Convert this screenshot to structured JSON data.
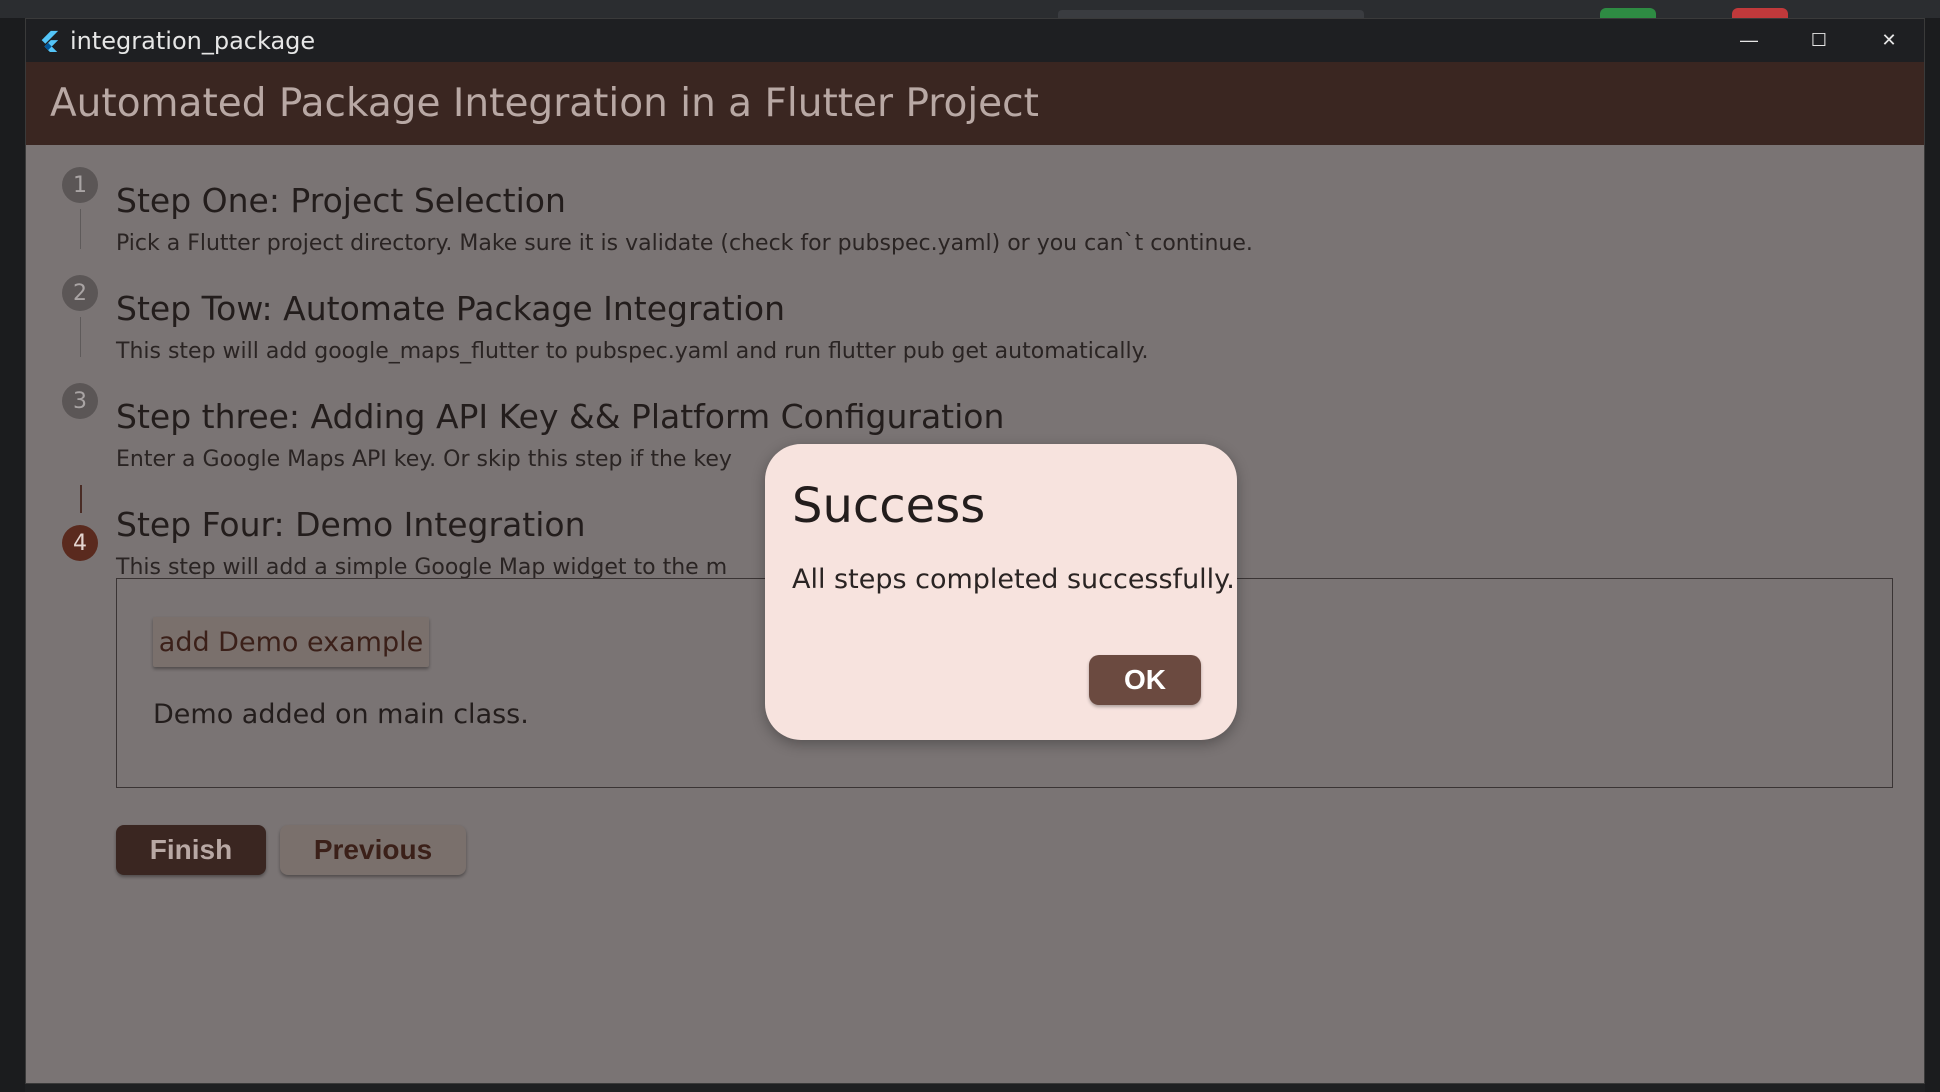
{
  "window": {
    "title": "integration_package",
    "minimize_glyph": "—",
    "maximize_glyph": "☐",
    "close_glyph": "✕"
  },
  "appbar": {
    "title": "Automated Package Integration in a Flutter Project"
  },
  "steps": [
    {
      "number": "1",
      "title": "Step One: Project Selection",
      "subtitle": "Pick a Flutter project directory. Make sure it is validate (check for pubspec.yaml) or you can`t continue."
    },
    {
      "number": "2",
      "title": "Step Tow: Automate Package Integration",
      "subtitle": "This step will add google_maps_flutter to pubspec.yaml and run flutter pub get automatically."
    },
    {
      "number": "3",
      "title": "Step three: Adding API Key && Platform Configuration",
      "subtitle": "Enter a Google Maps API key. Or skip this step if the key"
    },
    {
      "number": "4",
      "title": "Step Four: Demo Integration",
      "subtitle": "This step will add a simple Google Map widget to the m"
    }
  ],
  "demo": {
    "button_label": "add Demo example",
    "status": "Demo added on main class."
  },
  "controls": {
    "finish_label": "Finish",
    "previous_label": "Previous"
  },
  "dialog": {
    "title": "Success",
    "body": "All steps completed successfully.",
    "ok_label": "OK"
  },
  "colors": {
    "appbar": "#3a2621",
    "overlay_background": "#7a7474",
    "dialog_background": "#f7e3de",
    "ok_button": "#6b4a40",
    "active_step": "#5a2a1e"
  }
}
